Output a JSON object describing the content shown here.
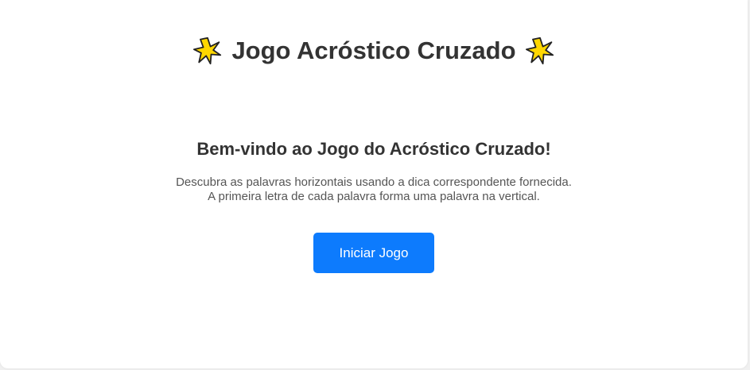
{
  "header": {
    "title": "Jogo Acróstico Cruzado",
    "star_icon": "glowing-star-icon",
    "star_color": "#ffd700"
  },
  "intro": {
    "heading": "Bem-vindo ao Jogo do Acróstico Cruzado!",
    "description_line1": "Descubra as palavras horizontais usando a dica correspondente fornecida.",
    "description_line2": "A primeira letra de cada palavra forma uma palavra na vertical."
  },
  "actions": {
    "start_label": "Iniciar Jogo",
    "start_color": "#0d7bfd"
  }
}
